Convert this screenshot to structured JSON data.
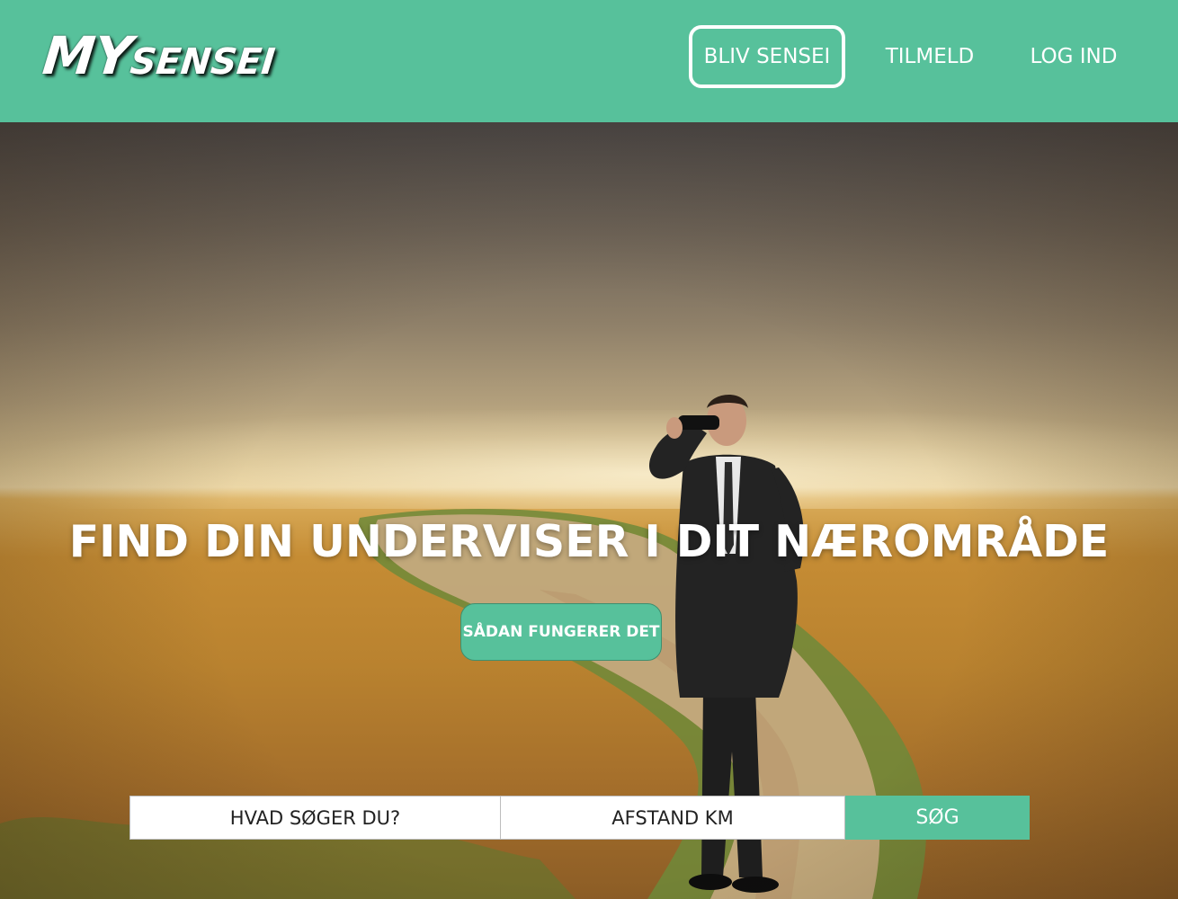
{
  "header": {
    "logo": {
      "part1": "MY",
      "part2": "SENSEI"
    },
    "nav": {
      "become_sensei": "BLIV SENSEI",
      "signup": "TILMELD",
      "login": "LOG IND"
    }
  },
  "hero": {
    "headline": "FIND DIN UNDERVISER I DIT NÆROMRÅDE",
    "how_button": "SÅDAN FUNGERER DET",
    "search": {
      "what_placeholder": "HVAD SØGER DU?",
      "distance_placeholder": "AFSTAND KM",
      "submit_label": "SØG"
    }
  },
  "colors": {
    "brand_green": "#57c19b",
    "white": "#ffffff"
  },
  "icons": {
    "hero_image": "man-with-binoculars-on-country-road"
  }
}
